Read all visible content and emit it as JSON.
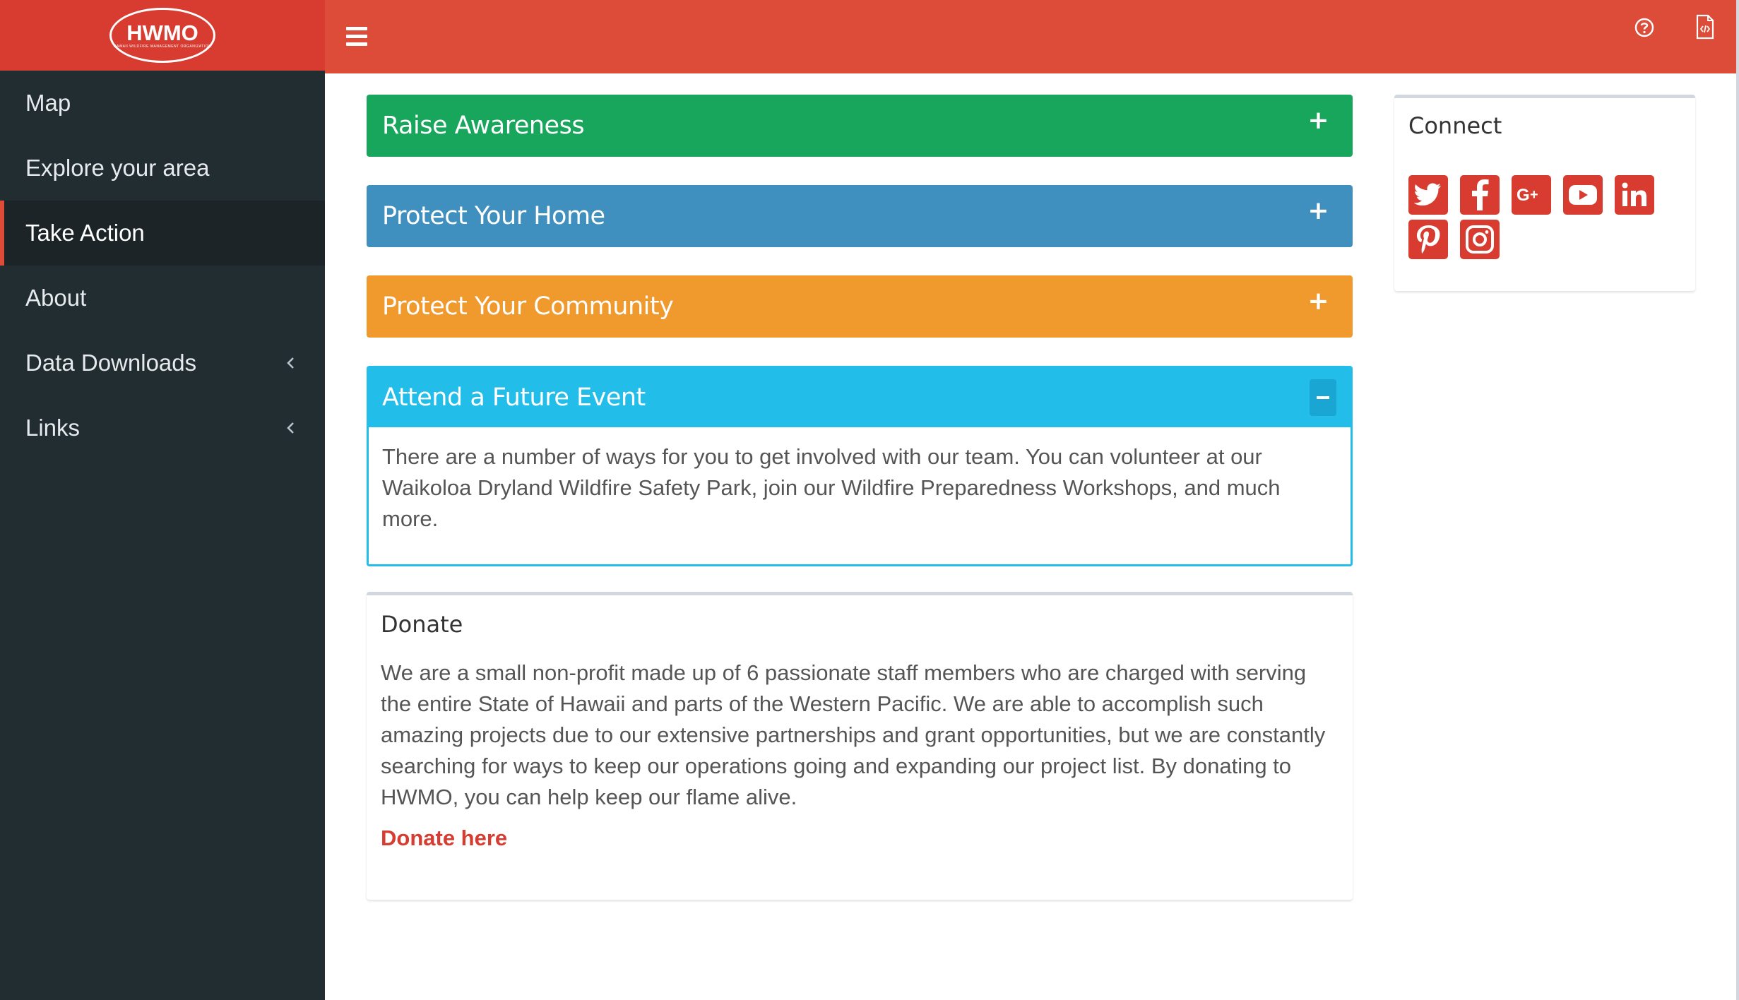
{
  "brand": {
    "logo_text": "HWMO",
    "logo_subtext": "HAWAII WILDFIRE MANAGEMENT ORGANIZATION",
    "accent_color": "#dd4b39",
    "sidebar_color": "#222d32"
  },
  "sidebar": {
    "items": [
      {
        "label": "Map",
        "active": false,
        "chevron": false
      },
      {
        "label": "Explore your area",
        "active": false,
        "chevron": false
      },
      {
        "label": "Take Action",
        "active": true,
        "chevron": false
      },
      {
        "label": "About",
        "active": false,
        "chevron": false
      },
      {
        "label": "Data Downloads",
        "active": false,
        "chevron": true
      },
      {
        "label": "Links",
        "active": false,
        "chevron": true
      }
    ]
  },
  "topbar": {
    "menu_icon": "hamburger-icon",
    "help_icon": "question-circle-icon",
    "doc_icon": "code-file-icon"
  },
  "accordions": [
    {
      "title": "Raise Awareness",
      "color": "#18a65c",
      "expanded": false
    },
    {
      "title": "Protect Your Home",
      "color": "#3f8fbf",
      "expanded": false
    },
    {
      "title": "Protect Your Community",
      "color": "#f0992d",
      "expanded": false
    },
    {
      "title": "Attend a Future Event",
      "color": "#22bde9",
      "expanded": true,
      "body": "There are a number of ways for you to get involved with our team. You can volunteer at our Waikoloa Dryland Wildfire Safety Park, join our Wildfire Preparedness Workshops, and much more."
    }
  ],
  "donate": {
    "title": "Donate",
    "text": "We are a small non-profit made up of 6 passionate staff members who are charged with serving the entire State of Hawaii and parts of the Western Pacific. We are able to accomplish such amazing projects due to our extensive partnerships and grant opportunities, but we are constantly searching for ways to keep our operations going and expanding our project list. By donating to HWMO, you can help keep our flame alive.",
    "link_label": "Donate here"
  },
  "connect": {
    "title": "Connect",
    "icons": [
      "twitter-icon",
      "facebook-icon",
      "google-plus-icon",
      "youtube-icon",
      "linkedin-icon",
      "pinterest-icon",
      "instagram-icon"
    ]
  }
}
